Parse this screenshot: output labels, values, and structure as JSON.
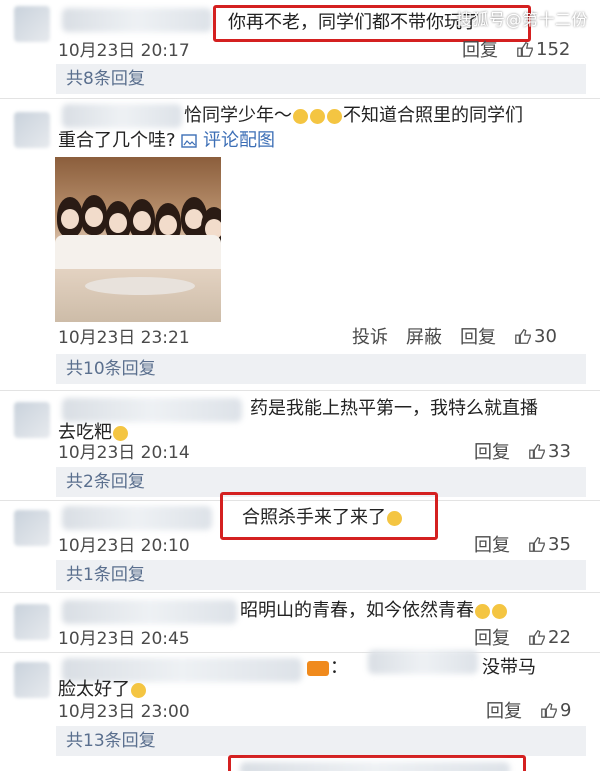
{
  "watermark": "搜狐号@第十二份",
  "comments": [
    {
      "text": "你再不老，同学们都不带你玩了",
      "time": "10月23日 20:17",
      "reply": "回复",
      "likes": "152"
    },
    {
      "text_line1": "恰同学少年～",
      "text_line1b": "不知道合照里的同学们",
      "text_line2": "重合了几个哇?",
      "photo_link": "评论配图",
      "time": "10月23日 23:21",
      "report": "投诉",
      "block": "屏蔽",
      "reply": "回复",
      "likes": "30"
    },
    {
      "text_line1": "药是我能上热平第一，我特么就直播",
      "text_line2": "去吃粑",
      "time": "10月23日 20:14",
      "reply": "回复",
      "likes": "33"
    },
    {
      "text": "合照杀手来了来了",
      "time": "10月23日 20:10",
      "reply": "回复",
      "likes": "35"
    },
    {
      "text": "昭明山的青春，如今依然青春",
      "time": "10月23日 20:45",
      "reply": "回复",
      "likes": "22"
    },
    {
      "text_line1": "：",
      "text_line1b": "没带马",
      "text_line2": "脸太好了",
      "time": "10月23日 23:00",
      "reply": "回复",
      "likes": "9"
    }
  ],
  "reply_bars": [
    "共8条回复",
    "共10条回复",
    "共2条回复",
    "共1条回复",
    "共13条回复"
  ],
  "colors": {
    "accent_red": "#d42020",
    "link_blue": "#5a6f8e"
  },
  "icons": {
    "like": "thumbs-up-icon",
    "image": "image-icon"
  }
}
